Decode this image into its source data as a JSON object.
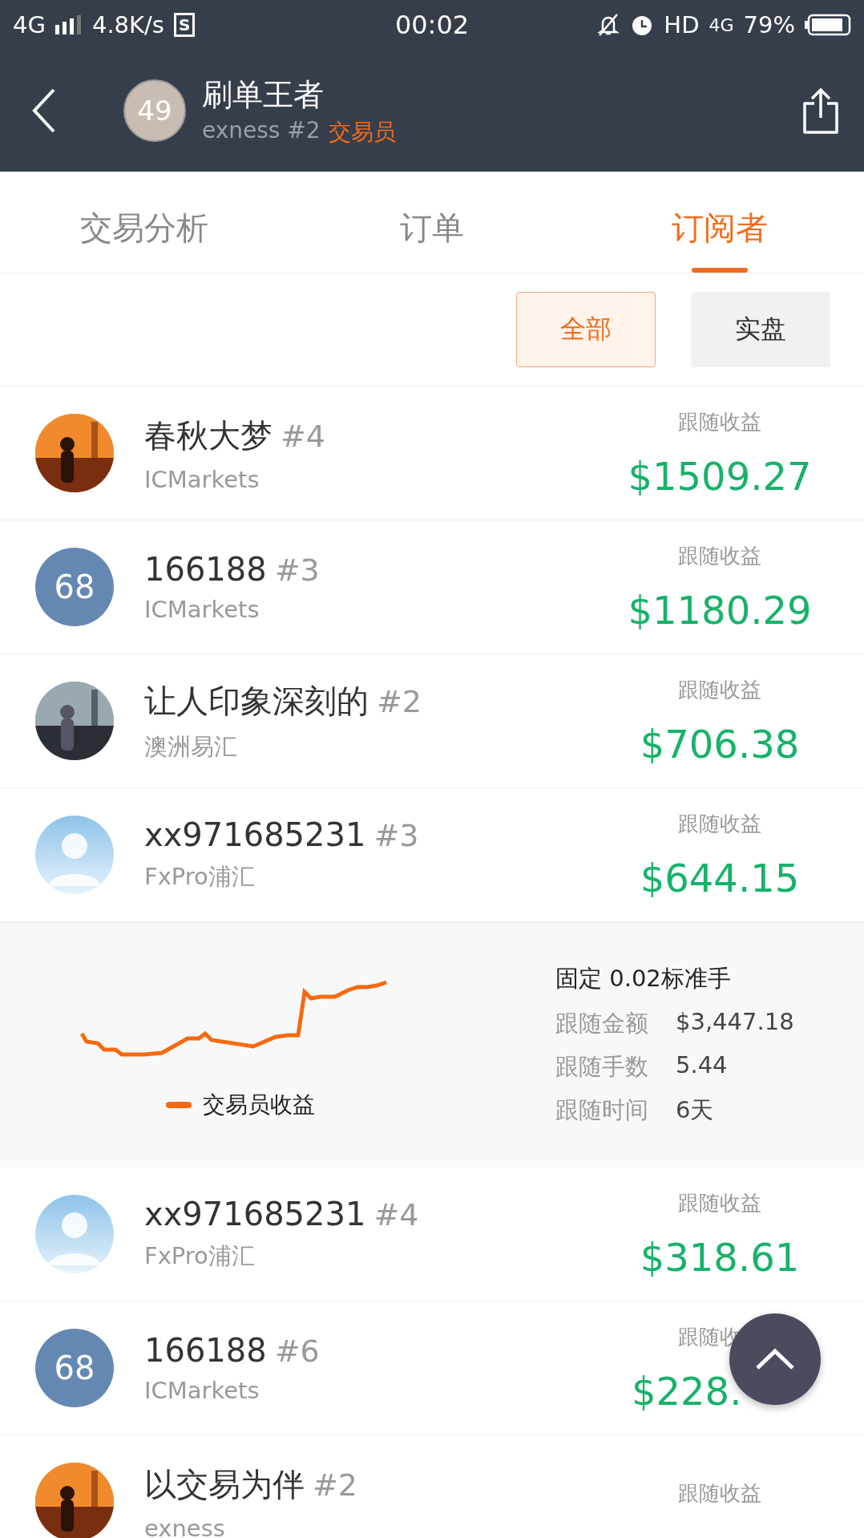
{
  "status_bar": {
    "network": "4G",
    "speed": "4.8K/s",
    "s_badge": "S",
    "time": "00:02",
    "hd": "HD",
    "network_right": "4G",
    "battery": "79%"
  },
  "header": {
    "avatar_number": "49",
    "title": "刷单王者",
    "subtitle": "exness #2",
    "role": "交易员"
  },
  "tabs": [
    {
      "label": "交易分析",
      "selected": false
    },
    {
      "label": "订单",
      "selected": false
    },
    {
      "label": "订阅者",
      "selected": true
    }
  ],
  "filters": [
    {
      "label": "全部",
      "selected": true
    },
    {
      "label": "实盘",
      "selected": false
    }
  ],
  "subscribers": [
    {
      "name": "春秋大梦",
      "rank": "#4",
      "broker": "ICMarkets",
      "profit_label": "跟随收益",
      "profit": "$1509.27"
    },
    {
      "kind": "number",
      "avatar_number": "68",
      "name": "166188",
      "rank": "#3",
      "broker": "ICMarkets",
      "profit_label": "跟随收益",
      "profit": "$1180.29"
    },
    {
      "name": "让人印象深刻的",
      "rank": "#2",
      "broker": "澳洲易汇",
      "profit_label": "跟随收益",
      "profit": "$706.38"
    },
    {
      "kind": "default",
      "name": "xx971685231",
      "rank": "#3",
      "broker": "FxPro浦汇",
      "profit_label": "跟随收益",
      "profit": "$644.15",
      "detail": {
        "mode": "固定 0.02标准手",
        "legend": "交易员收益",
        "stats": [
          {
            "label": "跟随金额",
            "value": "$3,447.18"
          },
          {
            "label": "跟随手数",
            "value": "5.44"
          },
          {
            "label": "跟随时间",
            "value": "6天"
          }
        ]
      }
    },
    {
      "kind": "default",
      "name": "xx971685231",
      "rank": "#4",
      "broker": "FxPro浦汇",
      "profit_label": "跟随收益",
      "profit": "$318.61"
    },
    {
      "kind": "number",
      "avatar_number": "68",
      "name": "166188",
      "rank": "#6",
      "broker": "ICMarkets",
      "profit_label": "跟随收",
      "profit": "$228."
    },
    {
      "name": "以交易为伴",
      "rank": "#2",
      "broker": "exness",
      "profit_label": "跟随收益"
    }
  ]
}
